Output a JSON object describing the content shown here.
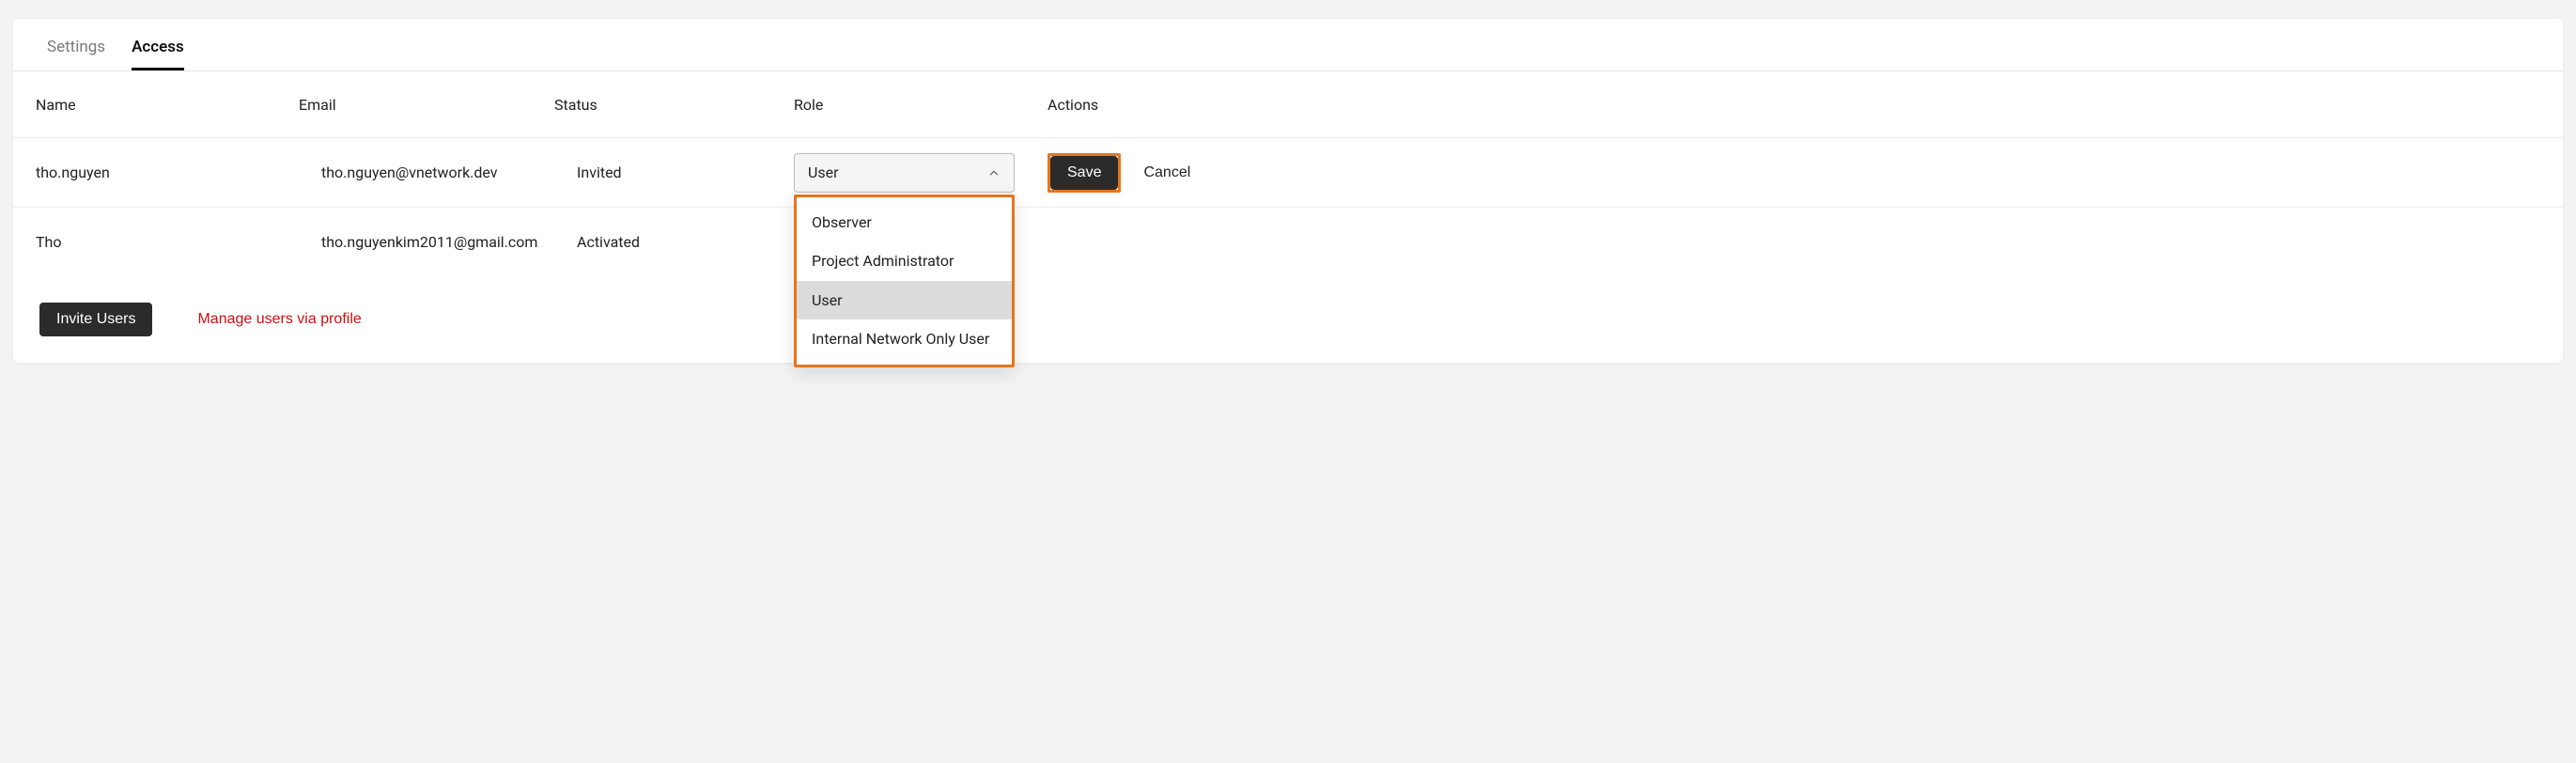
{
  "tabs": {
    "settings": "Settings",
    "access": "Access"
  },
  "columns": {
    "name": "Name",
    "email": "Email",
    "status": "Status",
    "role": "Role",
    "actions": "Actions"
  },
  "rows": [
    {
      "name": "tho.nguyen",
      "email": "tho.nguyen@vnetwork.dev",
      "status": "Invited",
      "role_selected": "User"
    },
    {
      "name": "Tho",
      "email": "tho.nguyenkim2011@gmail.com",
      "status": "Activated"
    }
  ],
  "role_dropdown": {
    "options": [
      "Observer",
      "Project Administrator",
      "User",
      "Internal Network Only User"
    ],
    "selected_index": 2
  },
  "actions": {
    "save": "Save",
    "cancel": "Cancel"
  },
  "footer": {
    "invite": "Invite Users",
    "manage": "Manage users via profile"
  }
}
